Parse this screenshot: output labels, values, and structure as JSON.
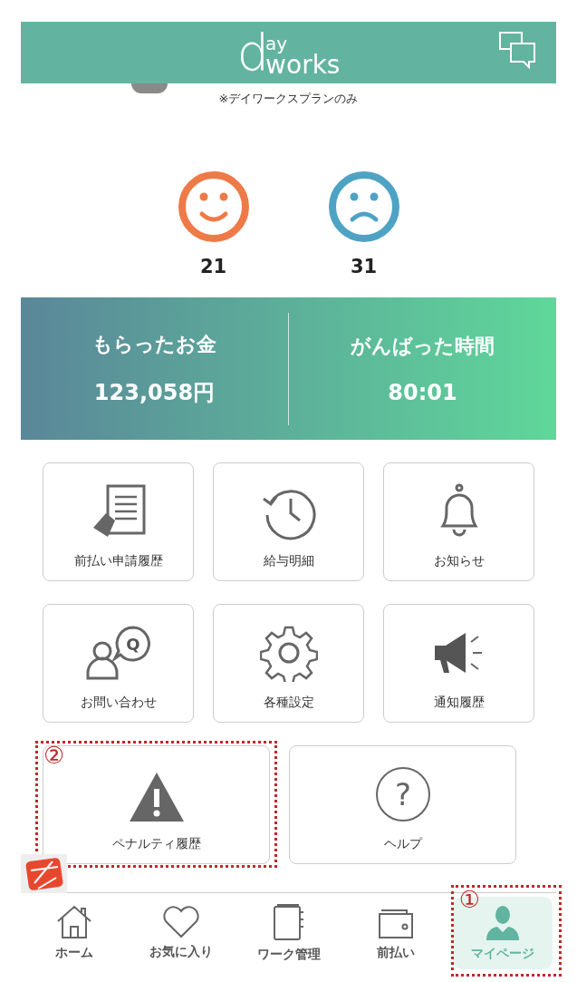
{
  "header": {
    "logo_letter": "d",
    "logo_top": "ay",
    "logo_bottom": "works"
  },
  "plan_note": "※デイワークスプランのみ",
  "evaluations": [
    {
      "kind": "good",
      "count": "21",
      "color": "#ee7a48"
    },
    {
      "kind": "bad",
      "count": "31",
      "color": "#4ea3c4"
    }
  ],
  "summary": [
    {
      "label": "もらったお金",
      "value": "123,058円"
    },
    {
      "label": "がんばった時間",
      "value": "80:01"
    }
  ],
  "menu_rows": [
    [
      {
        "kind": "document",
        "label": "前払い申請履歴"
      },
      {
        "kind": "history",
        "label": "給与明細"
      },
      {
        "kind": "bell",
        "label": "お知らせ"
      }
    ],
    [
      {
        "kind": "inquiry",
        "label": "お問い合わせ",
        "badge": "Q"
      },
      {
        "kind": "gear",
        "label": "各種設定"
      },
      {
        "kind": "megaphone",
        "label": "通知履歴"
      }
    ],
    [
      {
        "kind": "warning",
        "label": "ペナルティ履歴",
        "annotation": "②"
      },
      {
        "kind": "help",
        "label": "ヘルプ",
        "badge": "?"
      }
    ]
  ],
  "nav": [
    {
      "kind": "home",
      "label": "ホーム",
      "selected": false
    },
    {
      "kind": "heart",
      "label": "お気に入り",
      "selected": false
    },
    {
      "kind": "binder",
      "label": "ワーク管理",
      "selected": false
    },
    {
      "kind": "wallet",
      "label": "前払い",
      "selected": false
    },
    {
      "kind": "person",
      "label": "マイページ",
      "selected": true,
      "annotation": "①"
    }
  ]
}
